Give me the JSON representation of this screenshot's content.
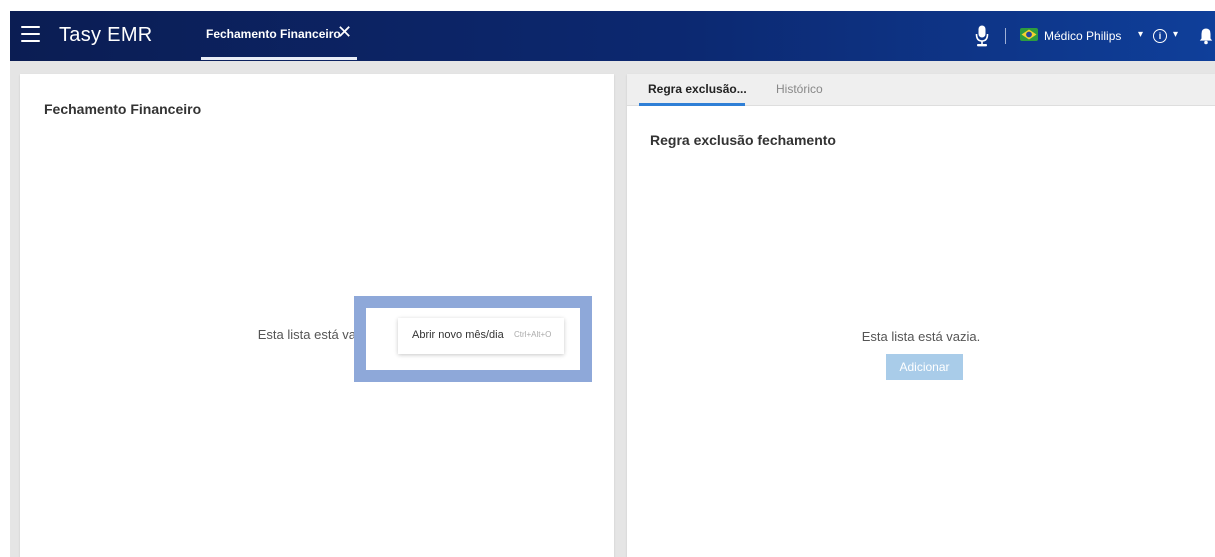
{
  "header": {
    "app_title": "Tasy EMR",
    "active_tab": {
      "label": "Fechamento Financeiro",
      "close_glyph": "✕"
    },
    "user": {
      "name": "Médico Philips",
      "caret": "▾"
    },
    "info": {
      "glyph": "i",
      "caret": "▾"
    },
    "icons": [
      "menu-icon",
      "microphone-icon",
      "brazil-flag-icon",
      "info-icon",
      "bell-icon"
    ]
  },
  "left_panel": {
    "title": "Fechamento Financeiro",
    "empty_message": "Esta lista está vazia.",
    "context_menu": {
      "item_label": "Abrir novo mês/dia",
      "item_shortcut": "Ctrl+Alt+O"
    }
  },
  "right_panel": {
    "tabs": [
      {
        "label": "Regra exclusão...",
        "active": true
      },
      {
        "label": "Histórico",
        "active": false
      }
    ],
    "title": "Regra exclusão fechamento",
    "empty_message": "Esta lista está vazia.",
    "add_button_label": "Adicionar"
  },
  "colors": {
    "header_gradient_start": "#0b1d53",
    "header_gradient_end": "#0f3f9a",
    "highlight_box": "#8ea8d9",
    "active_tab_underline": "#2f7fd6",
    "add_button": "#a9cce9",
    "content_background": "#e5e5e5"
  }
}
